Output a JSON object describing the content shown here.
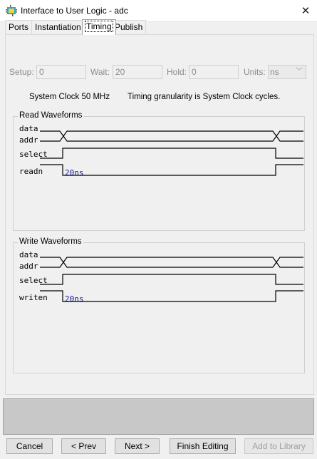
{
  "window": {
    "title": "Interface to User Logic - adc",
    "close_glyph": "✕"
  },
  "tabs": [
    {
      "label": "Ports",
      "active": false
    },
    {
      "label": "Instantiation",
      "active": false
    },
    {
      "label": "Timing",
      "active": true
    },
    {
      "label": "Publish",
      "active": false
    }
  ],
  "timing": {
    "setup_label": "Setup:",
    "setup_value": "0",
    "wait_label": "Wait:",
    "wait_value": "20",
    "hold_label": "Hold:",
    "hold_value": "0",
    "units_label": "Units:",
    "units_value": "ns",
    "clock_text": "System Clock 50 MHz",
    "granularity_text": "Timing granularity is System Clock cycles."
  },
  "read_waveforms": {
    "title": "Read Waveforms",
    "signals": [
      "data",
      "addr",
      "select",
      "readn"
    ],
    "duration_label": "20ns"
  },
  "write_waveforms": {
    "title": "Write Waveforms",
    "signals": [
      "data",
      "addr",
      "select",
      "writen"
    ],
    "duration_label": "20ns"
  },
  "buttons": {
    "cancel": "Cancel",
    "prev": "< Prev",
    "next": "Next >",
    "finish": "Finish Editing",
    "add_library": "Add to Library"
  }
}
